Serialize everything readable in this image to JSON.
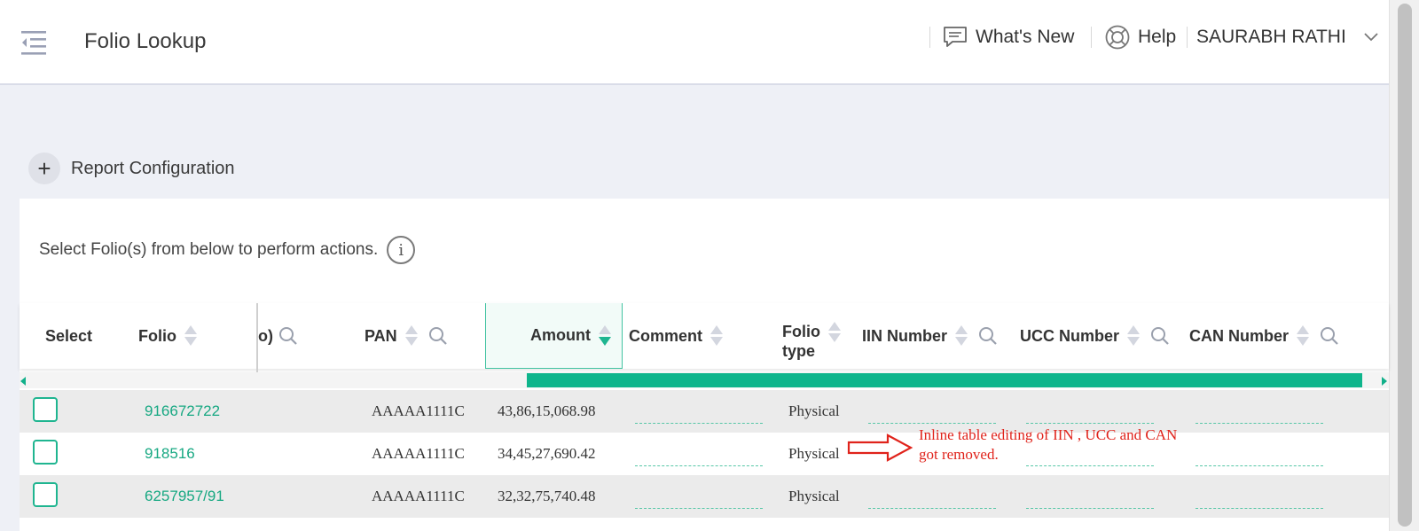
{
  "header": {
    "title": "Folio Lookup",
    "whats_new": "What's New",
    "help": "Help",
    "user": "SAURABH RATHI"
  },
  "report_config": {
    "label": "Report Configuration"
  },
  "hint": "Select Folio(s) from below to perform actions.",
  "table": {
    "columns": {
      "select": "Select",
      "folio": "Folio",
      "hidden_partial": "o)",
      "pan": "PAN",
      "amount": "Amount",
      "comment": "Comment",
      "folio_type_1": "Folio",
      "folio_type_2": "type",
      "iin": "IIN Number",
      "ucc": "UCC Number",
      "can": "CAN Number"
    },
    "rows": [
      {
        "folio": "916672722",
        "pan": "AAAAA1111C",
        "amount": "43,86,15,068.98",
        "folio_type": "Physical"
      },
      {
        "folio": "918516",
        "pan": "AAAAA1111C",
        "amount": "34,45,27,690.42",
        "folio_type": "Physical"
      },
      {
        "folio": "6257957/91",
        "pan": "AAAAA1111C",
        "amount": "32,32,75,740.48",
        "folio_type": "Physical"
      }
    ]
  },
  "annotation": {
    "line1": "Inline table editing of IIN , UCC and CAN",
    "line2": "got removed."
  },
  "colors": {
    "accent": "#1fb590",
    "annotation": "#e0231b"
  },
  "sort_state": {
    "amount": "descending"
  }
}
